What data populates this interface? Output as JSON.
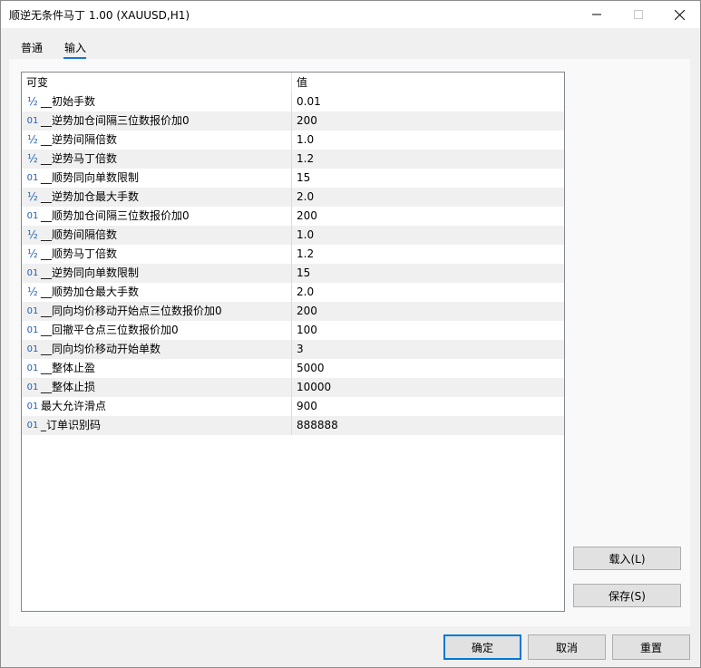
{
  "window": {
    "title": "顺逆无条件马丁 1.00 (XAUUSD,H1)"
  },
  "tabs": {
    "general": "普通",
    "input": "输入"
  },
  "grid": {
    "col_variable": "可变",
    "col_value": "值",
    "rows": [
      {
        "icon": "½",
        "type": "double",
        "name": "__初始手数",
        "value": "0.01"
      },
      {
        "icon": "01",
        "type": "int",
        "name": "__逆势加仓间隔三位数报价加0",
        "value": "200"
      },
      {
        "icon": "½",
        "type": "double",
        "name": "__逆势间隔倍数",
        "value": "1.0"
      },
      {
        "icon": "½",
        "type": "double",
        "name": "__逆势马丁倍数",
        "value": "1.2"
      },
      {
        "icon": "01",
        "type": "int",
        "name": "__顺势同向单数限制",
        "value": "15"
      },
      {
        "icon": "½",
        "type": "double",
        "name": "__逆势加仓最大手数",
        "value": "2.0"
      },
      {
        "icon": "01",
        "type": "int",
        "name": "__顺势加仓间隔三位数报价加0",
        "value": "200"
      },
      {
        "icon": "½",
        "type": "double",
        "name": "__顺势间隔倍数",
        "value": "1.0"
      },
      {
        "icon": "½",
        "type": "double",
        "name": "__顺势马丁倍数",
        "value": "1.2"
      },
      {
        "icon": "01",
        "type": "int",
        "name": "__逆势同向单数限制",
        "value": "15"
      },
      {
        "icon": "½",
        "type": "double",
        "name": "__顺势加仓最大手数",
        "value": "2.0"
      },
      {
        "icon": "01",
        "type": "int",
        "name": "__同向均价移动开始点三位数报价加0",
        "value": "200"
      },
      {
        "icon": "01",
        "type": "int",
        "name": "__回撤平仓点三位数报价加0",
        "value": "100"
      },
      {
        "icon": "01",
        "type": "int",
        "name": "__同向均价移动开始单数",
        "value": "3"
      },
      {
        "icon": "01",
        "type": "int",
        "name": "__整体止盈",
        "value": "5000"
      },
      {
        "icon": "01",
        "type": "int",
        "name": "__整体止损",
        "value": "10000"
      },
      {
        "icon": "01",
        "type": "int",
        "name": "最大允许滑点",
        "value": "900"
      },
      {
        "icon": "01",
        "type": "int",
        "name": "_订单识别码",
        "value": "888888"
      }
    ]
  },
  "side_buttons": {
    "load": "载入(L)",
    "save": "保存(S)"
  },
  "footer_buttons": {
    "ok": "确定",
    "cancel": "取消",
    "reset": "重置"
  },
  "colors": {
    "accent": "#0078d7",
    "tab_underline": "#1a73d9",
    "icon_blue": "#1e5fb4"
  }
}
